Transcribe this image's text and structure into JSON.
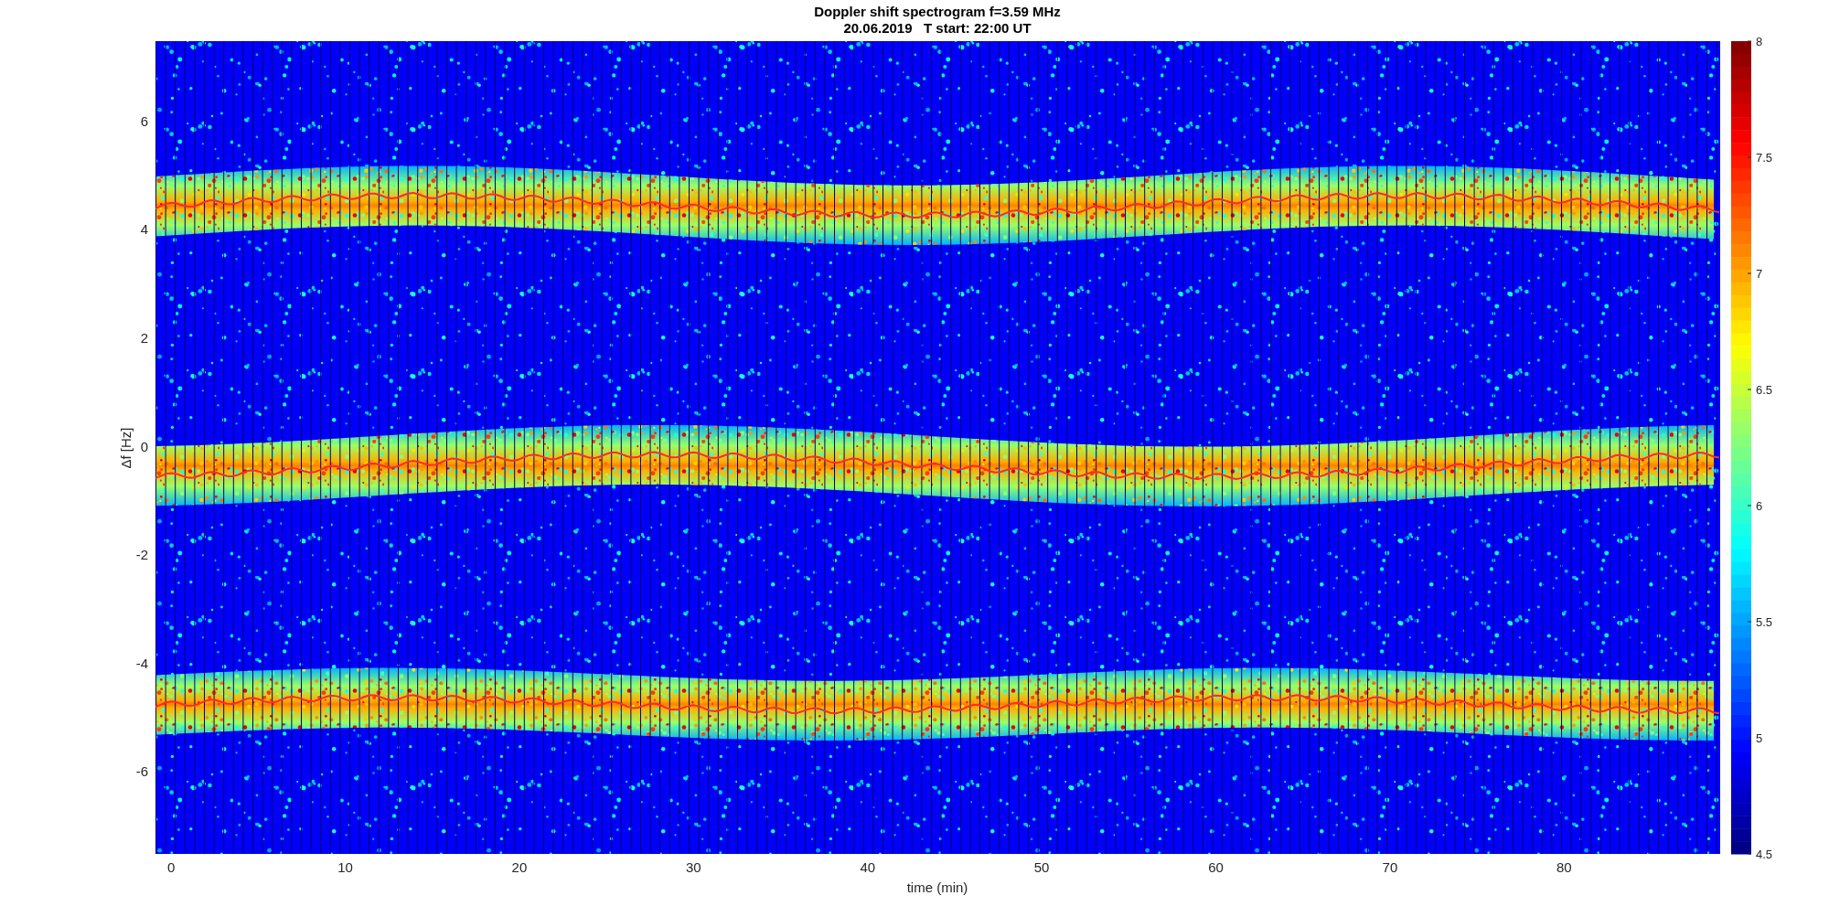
{
  "figure": {
    "title_lines": [
      "Doppler shift spectrogram f=3.59 MHz",
      "20.06.2019   T start: 22:00 UT"
    ]
  },
  "axes": {
    "xlabel": "time (min)",
    "ylabel": "Δf [Hz]",
    "xticks": [
      "0",
      "10",
      "20",
      "30",
      "40",
      "50",
      "60",
      "70",
      "80"
    ],
    "yticks": [
      "6",
      "4",
      "2",
      "0",
      "-2",
      "-4",
      "-6"
    ]
  },
  "colorbar": {
    "ticks": [
      "8",
      "7.5",
      "7",
      "6.5",
      "6",
      "5.5",
      "5",
      "4.5"
    ]
  }
}
